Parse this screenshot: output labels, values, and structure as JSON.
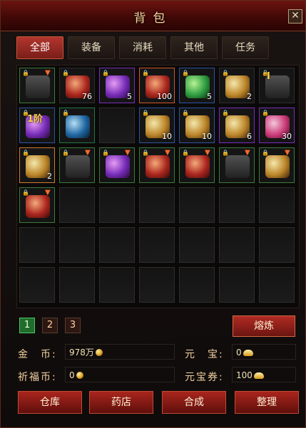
{
  "window": {
    "title": "背包",
    "close_label": "✕"
  },
  "tabs": [
    {
      "label": "全部",
      "active": true
    },
    {
      "label": "装备",
      "active": false
    },
    {
      "label": "消耗",
      "active": false
    },
    {
      "label": "其他",
      "active": false
    },
    {
      "label": "任务",
      "active": false
    }
  ],
  "inventory": {
    "cols": 7,
    "rows": 6,
    "items": [
      {
        "icon": "double-sword-icon",
        "tone": "gray",
        "border": "#3b7a3b",
        "lock": true,
        "arrow": true,
        "count": ""
      },
      {
        "icon": "potion-red-icon",
        "tone": "red",
        "border": "#2d2d2d",
        "lock": true,
        "arrow": false,
        "count": "76"
      },
      {
        "icon": "map-scroll-icon",
        "tone": "purple",
        "border": "#7b2bbf",
        "lock": true,
        "arrow": false,
        "count": "5"
      },
      {
        "icon": "treasure-chest-icon",
        "tone": "red",
        "border": "#d0562c",
        "lock": true,
        "arrow": false,
        "count": "100"
      },
      {
        "icon": "leaf-gem-icon",
        "tone": "green",
        "border": "#2c53a6",
        "lock": true,
        "arrow": false,
        "count": "5"
      },
      {
        "icon": "treasure-map-icon",
        "tone": "gold",
        "border": "#2d2d2d",
        "lock": true,
        "arrow": false,
        "count": "2"
      },
      {
        "icon": "rune-block-icon",
        "tone": "gray",
        "border": "#2d2d2d",
        "lock": true,
        "arrow": false,
        "count": "",
        "badge": "I"
      },
      {
        "icon": "tier-scroll-icon",
        "tone": "purple",
        "border": "#2c53a6",
        "lock": true,
        "arrow": false,
        "count": "",
        "badge": "1阶"
      },
      {
        "icon": "exp-orb-icon",
        "tone": "blue",
        "border": "#1d7a44",
        "lock": true,
        "arrow": false,
        "count": ""
      },
      {
        "icon": "empty-slot",
        "tone": "",
        "border": "#2d2d2d",
        "lock": false,
        "arrow": false,
        "count": ""
      },
      {
        "icon": "rolled-scroll-icon",
        "tone": "gold",
        "border": "#2c53a6",
        "lock": true,
        "arrow": false,
        "count": "10"
      },
      {
        "icon": "rolled-scroll-icon",
        "tone": "gold",
        "border": "#2c53a6",
        "lock": true,
        "arrow": false,
        "count": "10"
      },
      {
        "icon": "ancient-scroll-icon",
        "tone": "gold",
        "border": "#7b2bbf",
        "lock": true,
        "arrow": false,
        "count": "6"
      },
      {
        "icon": "heart-potion-icon",
        "tone": "pink",
        "border": "#7b2bbf",
        "lock": true,
        "arrow": false,
        "count": "30"
      },
      {
        "icon": "book-icon",
        "tone": "gold",
        "border": "#d07a2c",
        "lock": true,
        "arrow": false,
        "count": "2"
      },
      {
        "icon": "helmet-icon",
        "tone": "gray",
        "border": "#3b7a3b",
        "lock": true,
        "arrow": true,
        "count": ""
      },
      {
        "icon": "amulet-icon",
        "tone": "purple",
        "border": "#3b7a3b",
        "lock": true,
        "arrow": true,
        "count": ""
      },
      {
        "icon": "armor-icon",
        "tone": "red",
        "border": "#3b7a3b",
        "lock": true,
        "arrow": true,
        "count": ""
      },
      {
        "icon": "boots-icon",
        "tone": "red",
        "border": "#3b7a3b",
        "lock": true,
        "arrow": true,
        "count": ""
      },
      {
        "icon": "double-sword-icon",
        "tone": "gray",
        "border": "#3b7a3b",
        "lock": true,
        "arrow": true,
        "count": ""
      },
      {
        "icon": "ring-icon",
        "tone": "gold",
        "border": "#3b7a3b",
        "lock": true,
        "arrow": true,
        "count": ""
      },
      {
        "icon": "blade-icon",
        "tone": "red",
        "border": "#3b7a3b",
        "lock": true,
        "arrow": true,
        "count": ""
      },
      {
        "icon": "empty-slot",
        "tone": "",
        "border": "#2d2d2d",
        "lock": false,
        "arrow": false,
        "count": ""
      },
      {
        "icon": "empty-slot",
        "tone": "",
        "border": "#2d2d2d",
        "lock": false,
        "arrow": false,
        "count": ""
      },
      {
        "icon": "empty-slot",
        "tone": "",
        "border": "#2d2d2d",
        "lock": false,
        "arrow": false,
        "count": ""
      },
      {
        "icon": "empty-slot",
        "tone": "",
        "border": "#2d2d2d",
        "lock": false,
        "arrow": false,
        "count": ""
      },
      {
        "icon": "empty-slot",
        "tone": "",
        "border": "#2d2d2d",
        "lock": false,
        "arrow": false,
        "count": ""
      },
      {
        "icon": "empty-slot",
        "tone": "",
        "border": "#2d2d2d",
        "lock": false,
        "arrow": false,
        "count": ""
      },
      {
        "icon": "empty-slot",
        "tone": "",
        "border": "#2d2d2d",
        "lock": false,
        "arrow": false,
        "count": ""
      },
      {
        "icon": "empty-slot",
        "tone": "",
        "border": "#2d2d2d",
        "lock": false,
        "arrow": false,
        "count": ""
      },
      {
        "icon": "empty-slot",
        "tone": "",
        "border": "#2d2d2d",
        "lock": false,
        "arrow": false,
        "count": ""
      },
      {
        "icon": "empty-slot",
        "tone": "",
        "border": "#2d2d2d",
        "lock": false,
        "arrow": false,
        "count": ""
      },
      {
        "icon": "empty-slot",
        "tone": "",
        "border": "#2d2d2d",
        "lock": false,
        "arrow": false,
        "count": ""
      },
      {
        "icon": "empty-slot",
        "tone": "",
        "border": "#2d2d2d",
        "lock": false,
        "arrow": false,
        "count": ""
      },
      {
        "icon": "empty-slot",
        "tone": "",
        "border": "#2d2d2d",
        "lock": false,
        "arrow": false,
        "count": ""
      },
      {
        "icon": "empty-slot",
        "tone": "",
        "border": "#2d2d2d",
        "lock": false,
        "arrow": false,
        "count": ""
      },
      {
        "icon": "empty-slot",
        "tone": "",
        "border": "#2d2d2d",
        "lock": false,
        "arrow": false,
        "count": ""
      },
      {
        "icon": "empty-slot",
        "tone": "",
        "border": "#2d2d2d",
        "lock": false,
        "arrow": false,
        "count": ""
      },
      {
        "icon": "empty-slot",
        "tone": "",
        "border": "#2d2d2d",
        "lock": false,
        "arrow": false,
        "count": ""
      },
      {
        "icon": "empty-slot",
        "tone": "",
        "border": "#2d2d2d",
        "lock": false,
        "arrow": false,
        "count": ""
      },
      {
        "icon": "empty-slot",
        "tone": "",
        "border": "#2d2d2d",
        "lock": false,
        "arrow": false,
        "count": ""
      },
      {
        "icon": "empty-slot",
        "tone": "",
        "border": "#2d2d2d",
        "lock": false,
        "arrow": false,
        "count": ""
      }
    ]
  },
  "pager": {
    "pages": [
      {
        "label": "1",
        "active": true
      },
      {
        "label": "2",
        "active": false
      },
      {
        "label": "3",
        "active": false
      }
    ]
  },
  "actions": {
    "smelt_label": "熔炼"
  },
  "currency": {
    "gold_label": "金　币:",
    "gold_value": "978万",
    "yuanbao_label": "元　宝:",
    "yuanbao_value": "0",
    "blessing_label": "祈福币:",
    "blessing_value": "0",
    "voucher_label": "元宝券:",
    "voucher_value": "100"
  },
  "bottom_buttons": [
    {
      "label": "仓库"
    },
    {
      "label": "药店"
    },
    {
      "label": "合成"
    },
    {
      "label": "整理"
    }
  ],
  "colors": {
    "accent_red": "#a9251d",
    "title_gold": "#f2d9a0",
    "active_page_green": "#1f6c2c"
  }
}
